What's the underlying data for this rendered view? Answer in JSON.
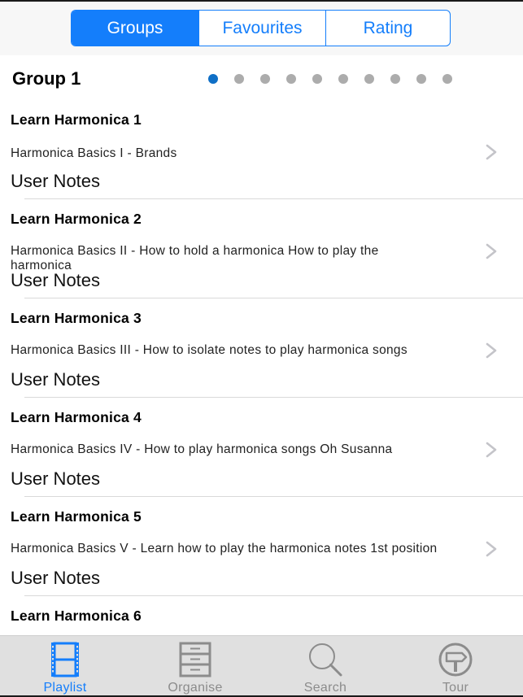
{
  "segmented_control": {
    "selected_index": 0,
    "segments": [
      {
        "label": "Groups"
      },
      {
        "label": "Favourites"
      },
      {
        "label": "Rating"
      }
    ]
  },
  "group": {
    "title": "Group 1",
    "page_count": 10,
    "current_page": 1
  },
  "list": {
    "items": [
      {
        "title": "Learn Harmonica 1",
        "subtitle": "Harmonica Basics I - Brands",
        "notes": "User Notes"
      },
      {
        "title": "Learn Harmonica 2",
        "subtitle": "Harmonica Basics II - How to hold a harmonica How to play the harmonica",
        "notes": "User Notes"
      },
      {
        "title": "Learn Harmonica 3",
        "subtitle": "Harmonica Basics III - How to isolate notes to play harmonica songs",
        "notes": "User Notes"
      },
      {
        "title": "Learn Harmonica 4",
        "subtitle": "Harmonica Basics IV  - How to play harmonica songs Oh Susanna",
        "notes": "User Notes"
      },
      {
        "title": "Learn Harmonica 5",
        "subtitle": "Harmonica Basics V -  Learn how to play the harmonica notes 1st position",
        "notes": "User Notes"
      },
      {
        "title": "Learn Harmonica 6",
        "subtitle": "",
        "notes": ""
      }
    ],
    "accessory_icon": "chevron-right-icon"
  },
  "tabbar": {
    "selected_index": 0,
    "tabs": [
      {
        "label": "Playlist",
        "icon": "film-strip-icon"
      },
      {
        "label": "Organise",
        "icon": "file-cabinet-icon"
      },
      {
        "label": "Search",
        "icon": "magnifier-icon"
      },
      {
        "label": "Tour",
        "icon": "signpost-icon"
      }
    ]
  },
  "colors": {
    "accent": "#147efb",
    "page_dot_active": "#0f6fc6",
    "page_dot_inactive": "#acacac",
    "tab_inactive": "#8c8c8c",
    "tabbar_bg": "#e0e0e0",
    "header_bg": "#f7f7f7"
  }
}
